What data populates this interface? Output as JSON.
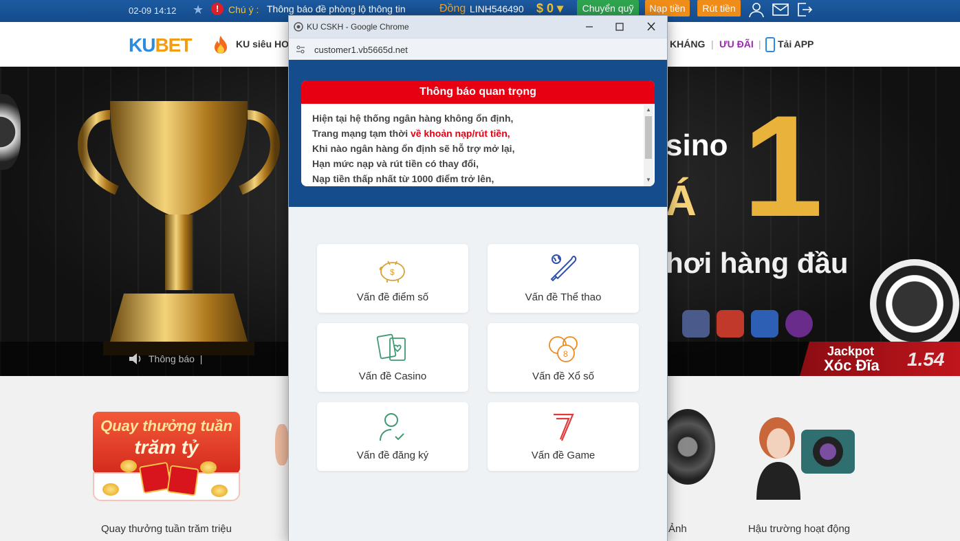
{
  "topbar": {
    "datetime": "02-09 14:12",
    "notice_label": "Chú ý :",
    "notice_text": "Thông báo đề phòng lộ thông tin",
    "currency_label": "Đồng",
    "username": "LINH546490",
    "balance": "$ 0 ▾",
    "transfer_label": "Chuyển quỹ",
    "deposit_label": "Nạp tiền",
    "withdraw_label": "Rút tiền"
  },
  "nav": {
    "logo_ku": "KU",
    "logo_bet": "BET",
    "item_ku": "KU siêu HO",
    "item_khang": "KHÁNG",
    "sep": "|",
    "item_uudai": "ƯU ĐÃI",
    "item_app": "Tải APP"
  },
  "hero": {
    "text1": "sino",
    "text2": "Á",
    "text_one": "1",
    "text3": "hơi hàng đầu",
    "notice_label": "Thông báo",
    "notice_sep": "|",
    "jackpot_title": "Jackpot",
    "jackpot_game": "Xóc Đĩa",
    "jackpot_value": "1.54"
  },
  "lower": {
    "promo_line1": "Quay thưởng tuần",
    "promo_line2": "trăm tỷ",
    "caption_left": "Quay thưởng tuần trăm triệu",
    "caption_anh": "Ảnh",
    "caption_right": "Hậu trường hoạt động"
  },
  "popup": {
    "window_title": "KU CSKH - Google Chrome",
    "url": "customer1.vb5665d.net",
    "notice_title": "Thông báo quan trọng",
    "notice_lines": {
      "l1": "Hiện tại hệ thống ngân hàng không ổn định,",
      "l2a": "Trang mạng tạm thời ",
      "l2b": "về khoản nạp/rút tiền,",
      "l3": "Khi nào ngân hàng ổn định sẽ hỗ trợ mở lại,",
      "l4": "Hạn mức nạp và rút tiền có thay đổi,",
      "l5": "Nạp tiền thấp nhất từ 1000 điểm trở lên,"
    },
    "tiles": {
      "points": "Vấn đề điểm số",
      "sports": "Vấn đề Thể thao",
      "casino": "Vấn đề Casino",
      "lottery": "Vấn đề Xổ số",
      "register": "Vấn đề đăng ký",
      "game": "Vấn đề Game"
    }
  },
  "colors": {
    "topbar": "#144c8c",
    "notice_red": "#e60012",
    "accent_green": "#2ea44f",
    "accent_orange": "#f08c18",
    "icon_gold": "#d8a23a",
    "icon_blue": "#2f4fa8",
    "icon_green": "#3f9a72",
    "icon_red": "#e23a3a"
  }
}
